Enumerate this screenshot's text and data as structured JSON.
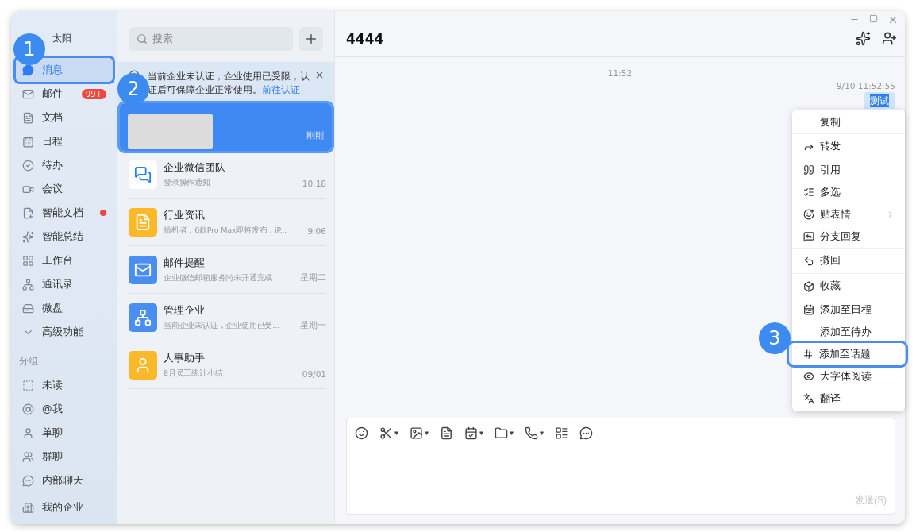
{
  "user": {
    "name": "太阳"
  },
  "sidebar": {
    "items": [
      {
        "label": "消息",
        "selected": true,
        "highlighted": true
      },
      {
        "label": "邮件",
        "selected": false,
        "badge": "99+"
      },
      {
        "label": "文档",
        "selected": false
      },
      {
        "label": "日程",
        "selected": false
      },
      {
        "label": "待办",
        "selected": false
      },
      {
        "label": "会议",
        "selected": false
      },
      {
        "label": "智能文档",
        "selected": false,
        "dot": true
      },
      {
        "label": "智能总结",
        "selected": false
      },
      {
        "label": "工作台",
        "selected": false
      },
      {
        "label": "通讯录",
        "selected": false
      },
      {
        "label": "微盘",
        "selected": false
      },
      {
        "label": "高级功能",
        "selected": false
      }
    ],
    "group_title": "分组",
    "groups": [
      {
        "label": "未读"
      },
      {
        "label": "@我"
      },
      {
        "label": "单聊"
      },
      {
        "label": "群聊"
      },
      {
        "label": "内部聊天"
      }
    ],
    "footer": {
      "label": "我的企业"
    }
  },
  "chat_list": {
    "search": {
      "placeholder": "搜索"
    },
    "notice": {
      "text": "当前企业未认证，企业使用已受限，认证后可保障企业正常使用。",
      "link": "前往认证"
    },
    "chats": [
      {
        "kind": "redacted",
        "time": "刚刚",
        "selected": true
      },
      {
        "kind": "chat",
        "title": "企业微信团队",
        "preview": "登录操作通知",
        "time": "10:18",
        "selected": false,
        "color": "#ffffff"
      },
      {
        "kind": "chat",
        "title": "行业资讯",
        "preview": "搞机者：6款Pro Max即将发布，iP...",
        "time": "9:06",
        "selected": false,
        "color": "#fbb829"
      },
      {
        "kind": "chat",
        "title": "邮件提醒",
        "preview": "企业微信邮箱服务尚未开通完成",
        "time": "星期二",
        "selected": false,
        "color": "#4a8ff0"
      },
      {
        "kind": "chat",
        "title": "管理企业",
        "preview": "当前企业未认证，企业使用已受...",
        "time": "星期一",
        "selected": false,
        "color": "#4a8ff0"
      },
      {
        "kind": "chat",
        "title": "人事助手",
        "preview": "8月员工统计小结",
        "time": "09/01",
        "selected": false,
        "color": "#fbb829"
      }
    ]
  },
  "conversation": {
    "title": "4444",
    "time_divider": "11:52",
    "message_time": "9/10 11:52:55",
    "message": {
      "text": "测试",
      "selected": true
    }
  },
  "context_menu": {
    "items": [
      {
        "label": "复制",
        "highlighted": false
      },
      {
        "label": "转发",
        "highlighted": false
      },
      {
        "label": "引用",
        "highlighted": false
      },
      {
        "label": "多选",
        "highlighted": false
      },
      {
        "label": "贴表情",
        "highlighted": false,
        "submenu": true
      },
      {
        "label": "分支回复",
        "highlighted": false
      },
      {
        "label": "撤回",
        "highlighted": false
      },
      {
        "label": "收藏",
        "highlighted": false
      },
      {
        "label": "添加至日程",
        "highlighted": false
      },
      {
        "label": "添加至待办",
        "highlighted": false
      },
      {
        "label": "添加至话题",
        "highlighted": true
      },
      {
        "label": "大字体阅读",
        "highlighted": false
      },
      {
        "label": "翻译",
        "highlighted": false
      }
    ]
  },
  "composer": {
    "send": {
      "label": "发送(S)",
      "disabled": true
    }
  },
  "step_markers": [
    {
      "label": "1"
    },
    {
      "label": "2"
    },
    {
      "label": "3"
    }
  ]
}
